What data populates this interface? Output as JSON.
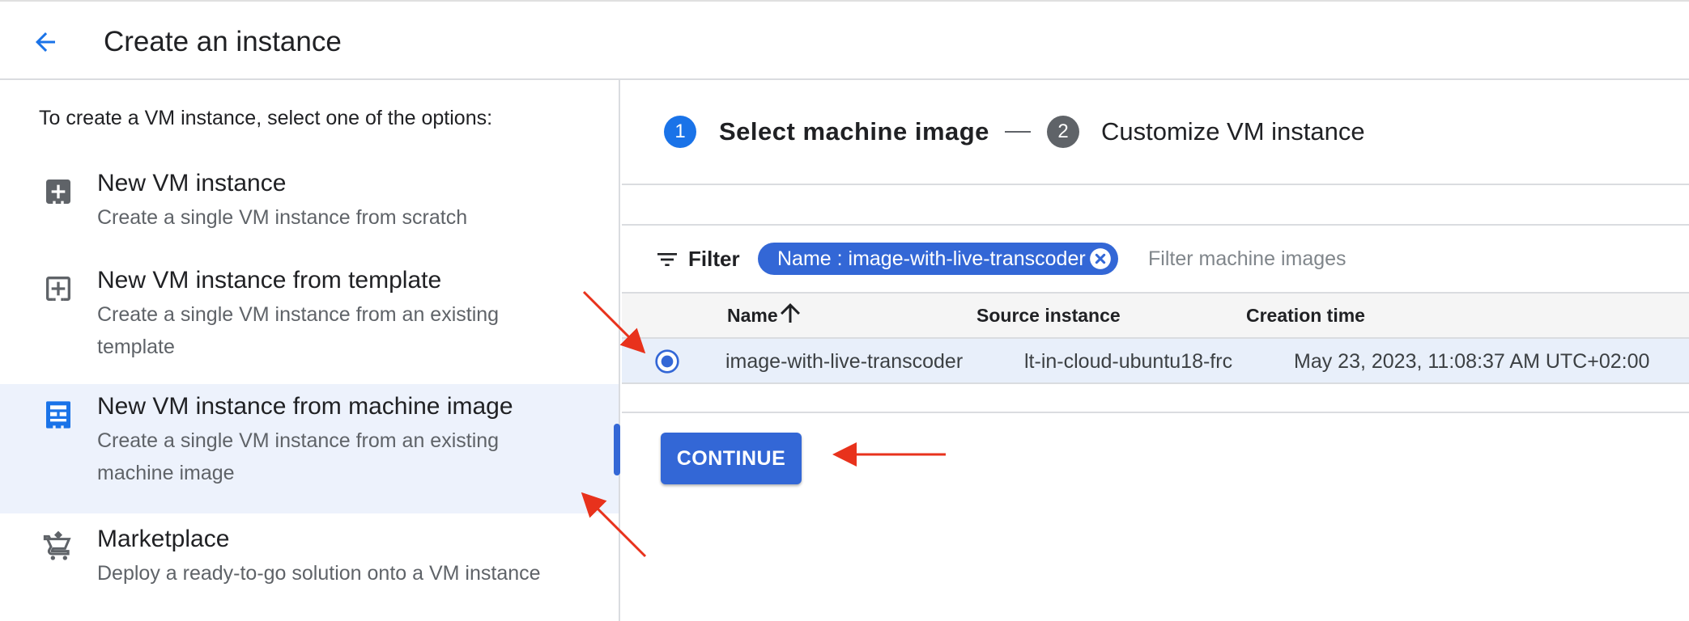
{
  "header": {
    "title": "Create an instance",
    "back_icon": "arrow-back-icon"
  },
  "left": {
    "intro": "To create a VM instance, select one of the options:",
    "options": [
      {
        "title": "New VM instance",
        "description": "Create a single VM instance from scratch",
        "icon": "add-box-icon",
        "selected": false
      },
      {
        "title": "New VM instance from template",
        "description": "Create a single VM instance from an existing template",
        "icon": "add-box-outline-icon",
        "selected": false
      },
      {
        "title": "New VM instance from machine image",
        "description": "Create a single VM instance from an existing machine image",
        "icon": "machine-image-icon",
        "selected": true
      },
      {
        "title": "Marketplace",
        "description": "Deploy a ready-to-go solution onto a VM instance",
        "icon": "cart-icon",
        "selected": false
      }
    ]
  },
  "stepper": {
    "steps": [
      {
        "number": "1",
        "label": "Select machine image",
        "active": true
      },
      {
        "number": "2",
        "label": "Customize VM instance",
        "active": false
      }
    ]
  },
  "filter": {
    "label": "Filter",
    "chip": "Name : image-with-live-transcoder",
    "placeholder": "Filter machine images"
  },
  "table": {
    "columns": [
      "Name",
      "Source instance",
      "Creation time"
    ],
    "sort": {
      "column": "Name",
      "direction": "ascending"
    },
    "rows": [
      {
        "selected": true,
        "cells": [
          "image-with-live-transcoder",
          "lt-in-cloud-ubuntu18-frc",
          "May 23, 2023, 11:08:37 AM UTC+02:00"
        ]
      }
    ]
  },
  "actions": {
    "continue_label": "CONTINUE"
  },
  "colors": {
    "accent": "#3367d6",
    "annotation_arrow": "#e8321c",
    "selected_bg": "#edf2fc"
  }
}
